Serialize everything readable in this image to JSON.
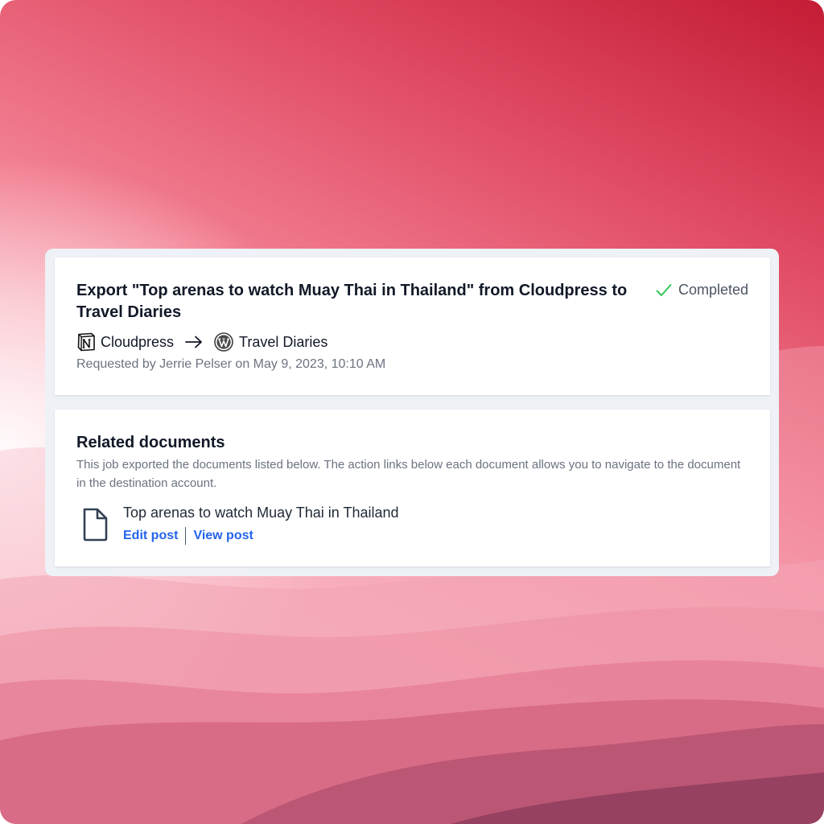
{
  "job": {
    "title": "Export \"Top arenas to watch Muay Thai in Thailand\" from Cloudpress to Travel Diaries",
    "status": "Completed",
    "status_color": "#34c759",
    "source": {
      "icon": "notion-icon",
      "name": "Cloudpress"
    },
    "destination": {
      "icon": "wordpress-icon",
      "name": "Travel Diaries"
    },
    "requested": "Requested by Jerrie Pelser on May 9, 2023, 10:10 AM"
  },
  "related": {
    "title": "Related documents",
    "description": "This job exported the documents listed below. The action links below each document allows you to navigate to the document in the destination account.",
    "documents": [
      {
        "icon": "document-icon",
        "title": "Top arenas to watch Muay Thai in Thailand",
        "actions": [
          "Edit post",
          "View post"
        ]
      }
    ]
  },
  "colors": {
    "link": "#2563eb",
    "background_top": "#c41c35",
    "background_light": "#fcd3da"
  }
}
